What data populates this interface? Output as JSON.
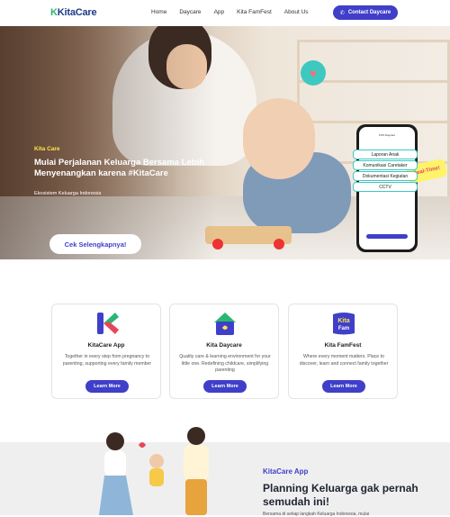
{
  "nav": {
    "logo": "KitaCare",
    "items": [
      "Home",
      "Daycare",
      "App",
      "Kita FamFest",
      "About Us"
    ],
    "cta_label": "Contact Daycare"
  },
  "hero": {
    "tag": "Kita Care",
    "title": "Mulai Perjalanan Keluarga Bersama Lebih Menyenangkan karena #KitaCare",
    "subtitle": "Ekosistem Keluarga Indonesia",
    "button_label": "Cek Selengkapnya!",
    "badge": "Real-Time!",
    "features": [
      "Laporan Anak",
      "Komunikasi Caretaker",
      "Dokumentasi Kegiatan",
      "CCTV"
    ],
    "phone_title": "KITA Daycare"
  },
  "cards": [
    {
      "title": "KitaCare App",
      "desc": "Together in every step from pregnancy to parenting, supporting every family member",
      "button": "Learn More"
    },
    {
      "title": "Kita Daycare",
      "desc": "Quality care & learning environment for your little one. Redefining childcare, simplifying parenting",
      "button": "Learn More"
    },
    {
      "title": "Kita FamFest",
      "desc": "Where every moment matters. Place to discover, learn and connect family together",
      "button": "Learn More"
    }
  ],
  "bottom": {
    "tag": "KitaCare App",
    "title": "Planning Keluarga gak pernah semudah ini!",
    "subtitle": "Bersama di setiap langkah Keluarga Indonesia, mulai"
  },
  "colors": {
    "accent": "#3f3fc9",
    "brand_green": "#2ab673",
    "highlight": "#ffe44d"
  }
}
